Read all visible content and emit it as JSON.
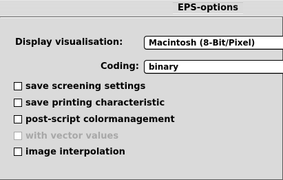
{
  "window": {
    "title": "EPS-options"
  },
  "display": {
    "label": "Display visualisation:",
    "value": "Macintosh (8-Bit/Pixel)"
  },
  "coding": {
    "label": "Coding:",
    "value": "binary"
  },
  "options": [
    {
      "label": "save screening settings",
      "checked": false,
      "enabled": true
    },
    {
      "label": "save printing characteristic",
      "checked": false,
      "enabled": true
    },
    {
      "label": "post-script colormanagement",
      "checked": false,
      "enabled": true
    },
    {
      "label": "with vector values",
      "checked": false,
      "enabled": false
    },
    {
      "label": "image interpolation",
      "checked": false,
      "enabled": true
    }
  ]
}
